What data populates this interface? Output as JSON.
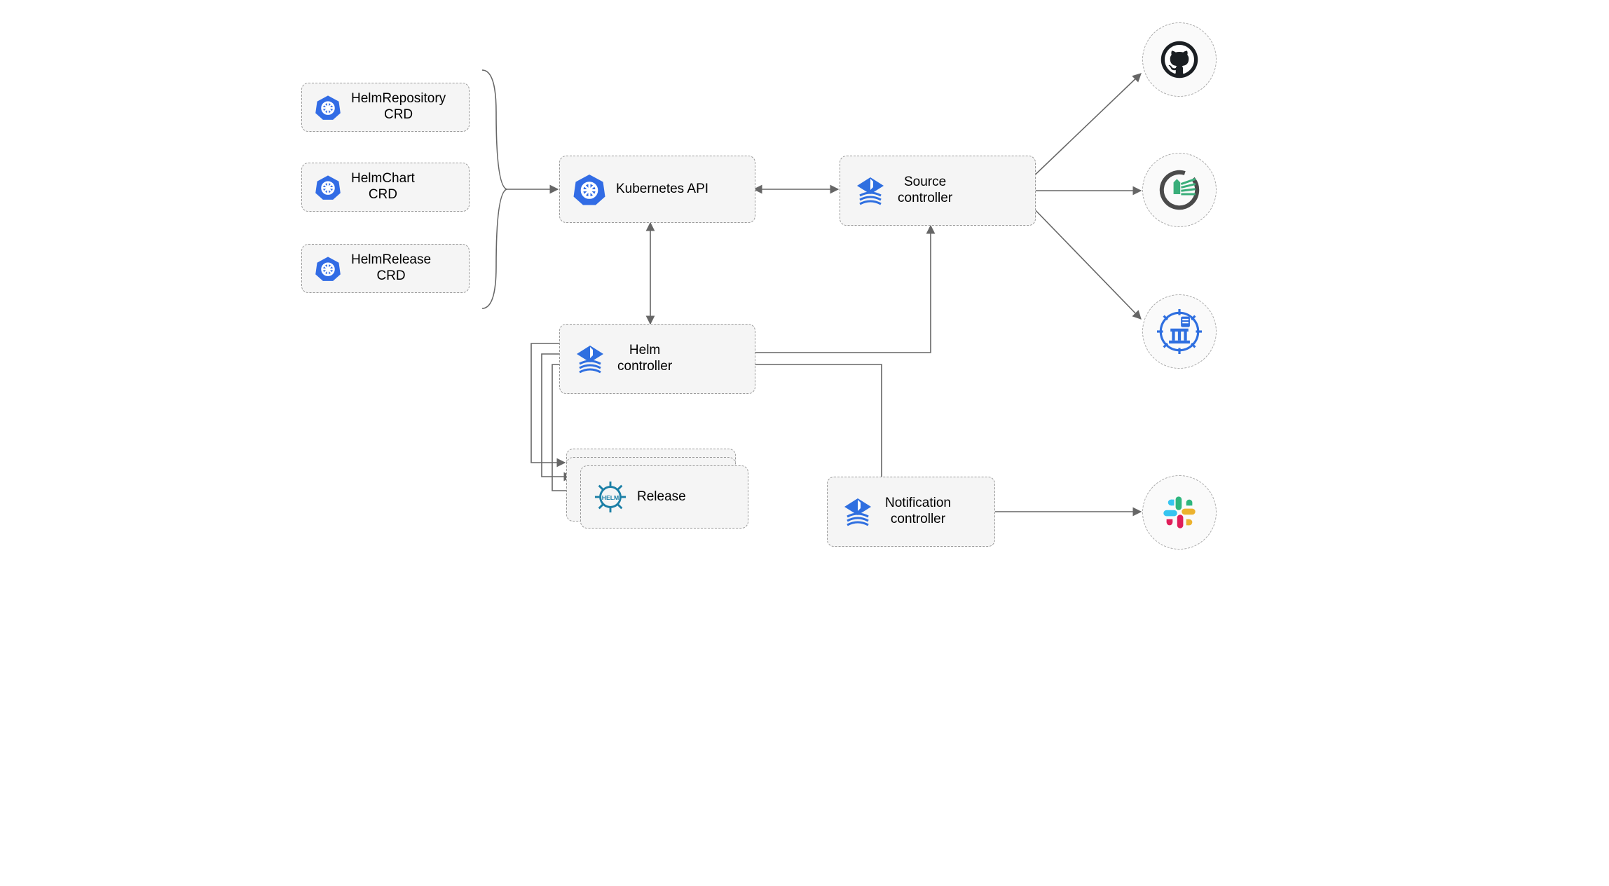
{
  "crds": {
    "repo": {
      "l1": "HelmRepository",
      "l2": "CRD"
    },
    "chart": {
      "l1": "HelmChart",
      "l2": "CRD"
    },
    "release": {
      "l1": "HelmRelease",
      "l2": "CRD"
    }
  },
  "k8s": "Kubernetes API",
  "source": {
    "l1": "Source",
    "l2": "controller"
  },
  "helm": {
    "l1": "Helm",
    "l2": "controller"
  },
  "notif": {
    "l1": "Notification",
    "l2": "controller"
  },
  "releaseNode": "Release",
  "icons": {
    "k8s": "kubernetes-icon",
    "flux": "flux-icon",
    "helm": "helm-icon",
    "github": "github-icon",
    "harbor": "harbor-icon",
    "steer": "museum-icon",
    "slack": "slack-icon"
  }
}
